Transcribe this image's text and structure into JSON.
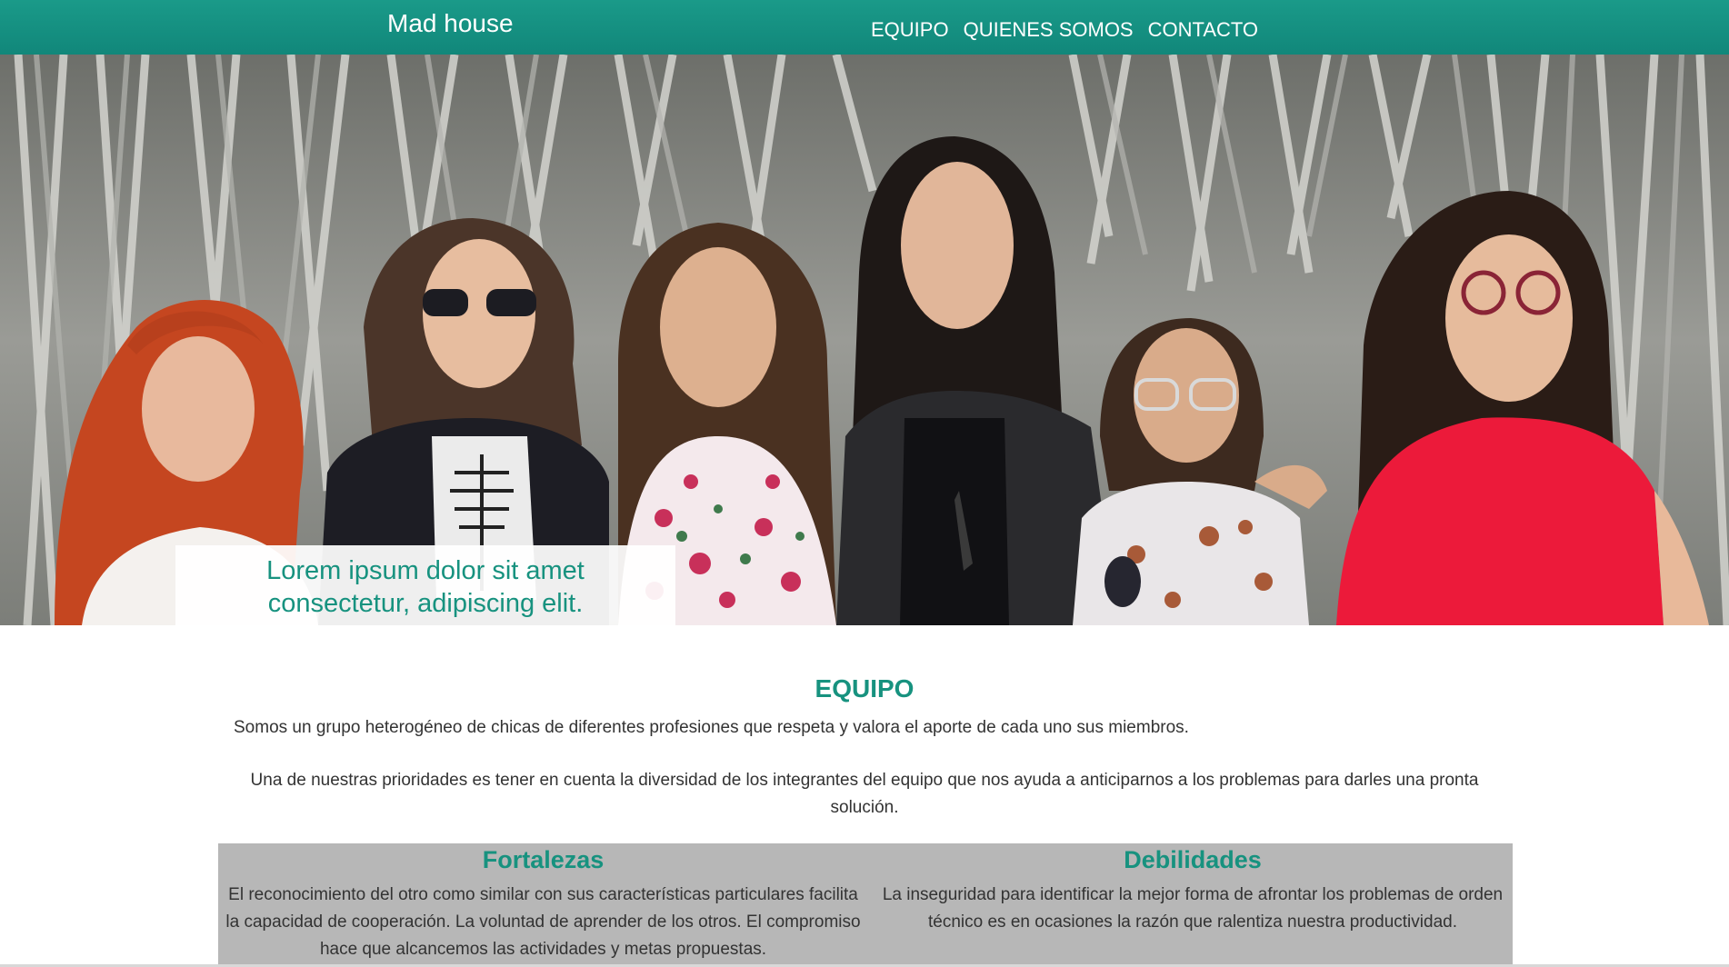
{
  "navbar": {
    "brand": "Mad house",
    "links": [
      "EQUIPO",
      "QUIENES SOMOS",
      "CONTACTO"
    ],
    "color": "#149281"
  },
  "hero": {
    "caption_line1": "Lorem ipsum dolor sit amet",
    "caption_line2": "consectetur, adipiscing elit.",
    "image": "team-photo"
  },
  "section": {
    "title": "EQUIPO",
    "paragraph1": "Somos un grupo heterogéneo de chicas de diferentes profesiones que respeta y valora el aporte de cada uno sus miembros.",
    "paragraph2": "Una de nuestras prioridades es tener en cuenta la diversidad de los integrantes del equipo que nos ayuda a anticiparnos a los problemas para darles una pronta solución."
  },
  "strengths": {
    "title": "Fortalezas",
    "text": "El reconocimiento del otro como similar con sus características particulares facilita la capacidad de cooperación. La voluntad de aprender de los otros. El compromiso hace que alcancemos las actividades y metas propuestas."
  },
  "weaknesses": {
    "title": "Debilidades",
    "text": "La inseguridad para identificar la mejor forma de afrontar los problemas de orden técnico es en ocasiones la razón que ralentiza nuestra productividad."
  },
  "colors": {
    "accent": "#17927f",
    "body_text": "#333333",
    "panel": "#b7b7b7"
  }
}
